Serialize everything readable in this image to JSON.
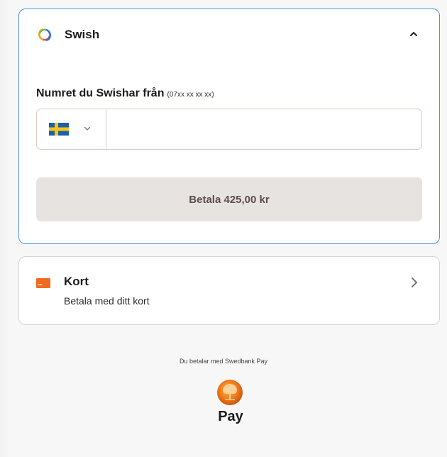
{
  "swish": {
    "title": "Swish",
    "field_label": "Numret du Swishar från",
    "field_hint": "(07xx xx xx xx)",
    "phone_value": "",
    "country": "Sverige",
    "pay_button_label": "Betala 425,00 kr"
  },
  "kort": {
    "title": "Kort",
    "subtitle": "Betala med ditt kort"
  },
  "footer": {
    "provider_text": "Du betalar med Swedbank Pay",
    "pay_label": "Pay"
  },
  "colors": {
    "active_border": "#4e97d6",
    "button_bg": "#e7e3e0",
    "card_icon": "#f26a21",
    "swedbank_orange": "#ee7a1c"
  },
  "icons": {
    "swish": "swish-logo-icon",
    "expand": "chevron-up-icon",
    "country": "sweden-flag-icon",
    "dropdown": "chevron-down-icon",
    "card": "credit-card-icon",
    "navigate": "chevron-right-icon",
    "provider": "swedbank-oak-logo"
  }
}
